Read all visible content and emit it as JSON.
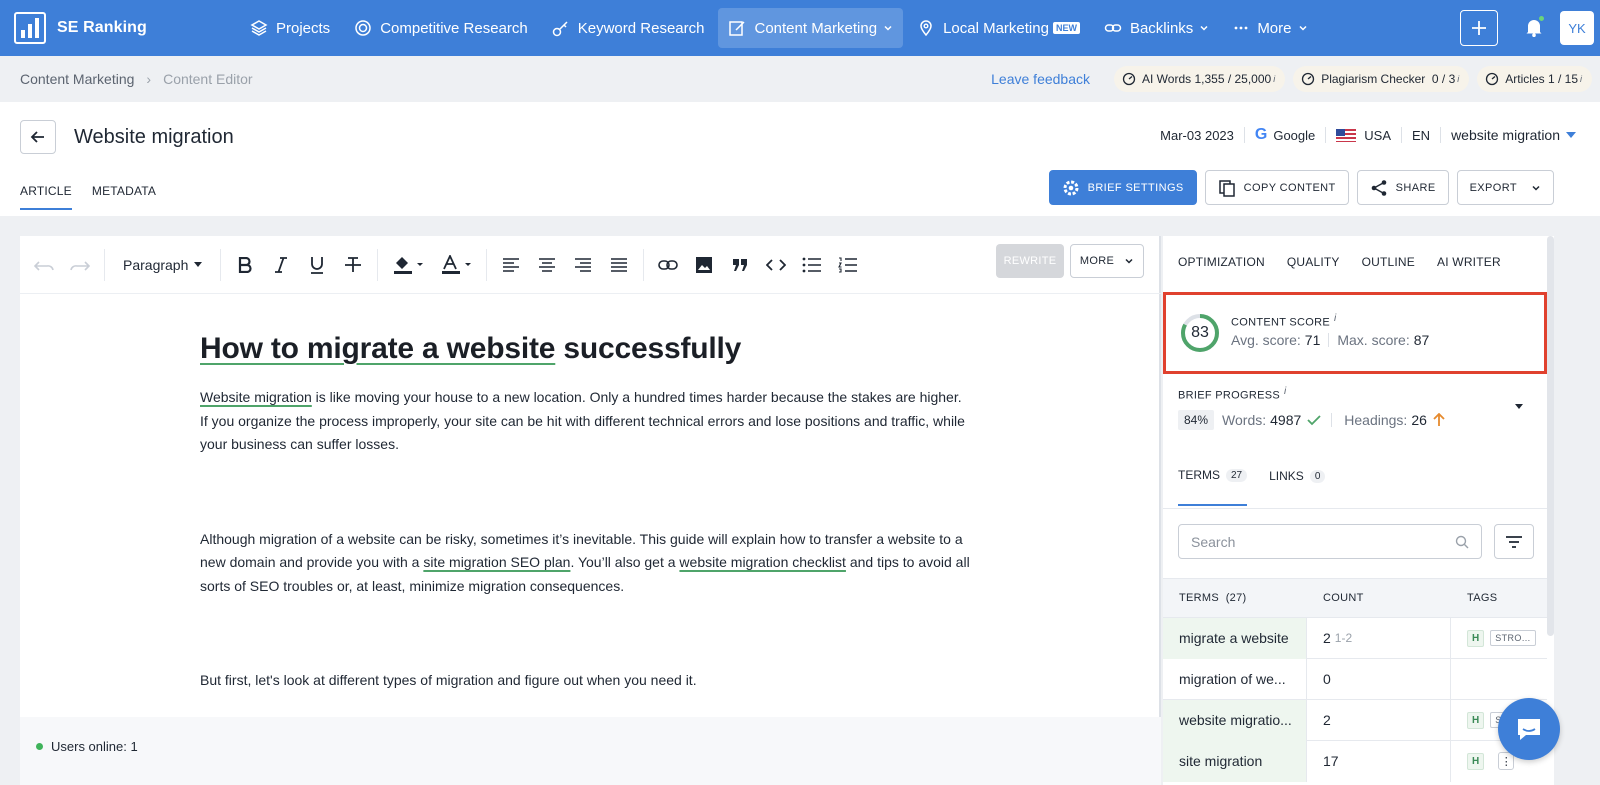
{
  "app": {
    "name": "SE Ranking",
    "avatar_initials": "YK",
    "brand_color": "#3e7fd8"
  },
  "nav": {
    "items": [
      {
        "label": "Projects",
        "icon": "layers-icon"
      },
      {
        "label": "Competitive Research",
        "icon": "target-icon"
      },
      {
        "label": "Keyword Research",
        "icon": "key-icon"
      },
      {
        "label": "Content Marketing",
        "icon": "edit-icon",
        "active": true
      },
      {
        "label": "Local Marketing",
        "icon": "pin-icon",
        "badge": "NEW"
      },
      {
        "label": "Backlinks",
        "icon": "link-icon"
      },
      {
        "label": "More",
        "icon": "dots-icon"
      }
    ]
  },
  "breadcrumb": {
    "parent": "Content Marketing",
    "current": "Content Editor"
  },
  "limits": {
    "feedback": "Leave feedback",
    "ai_words_label": "AI Words",
    "ai_words_value": "1,355 / 25,000",
    "plagiarism_label": "Plagiarism Checker",
    "plagiarism_value": "0 / 3",
    "articles_label": "Articles",
    "articles_value": "1 / 15",
    "info_mark": "i"
  },
  "document": {
    "title": "Website migration",
    "date": "Mar-03 2023",
    "engine_glyph": "G",
    "engine": "Google",
    "country": "USA",
    "language": "EN",
    "keyword": "website migration"
  },
  "tabs": {
    "article": "ARTICLE",
    "metadata": "METADATA"
  },
  "actions": {
    "brief_settings": "BRIEF SETTINGS",
    "copy_content": "COPY CONTENT",
    "share": "SHARE",
    "export": "EXPORT"
  },
  "toolbar": {
    "format": "Paragraph",
    "rewrite": "REWRITE",
    "more": "MORE"
  },
  "article": {
    "h1_part1": "How to migrate a website",
    "h1_part2": " successfully",
    "p1_link": "Website migration",
    "p1_rest": " is like moving your house to a new location. Only a hundred times harder because the stakes are higher. If you organize the process improperly, your site can be hit with different technical errors and lose positions and traffic, while your business can suffer losses.",
    "p2_a": "Although migration of a website can be risky, sometimes it’s inevitable. This guide will explain how to transfer a website to a new domain and provide you with a ",
    "p2_link1": "site migration SEO plan",
    "p2_b": ". You’ll also get a ",
    "p2_link2": "website migration checklist",
    "p2_c": " and tips to avoid all sorts of SEO troubles or, at least, minimize migration consequences.",
    "p3": "But first, let's look at different types of migration and figure out when you need it."
  },
  "status": {
    "online": "Users online: 1"
  },
  "sidebar": {
    "tabs": [
      "OPTIMIZATION",
      "QUALITY",
      "OUTLINE",
      "AI WRITER"
    ],
    "score": {
      "label": "CONTENT SCORE",
      "value": "83",
      "value_fraction": 0.83,
      "avg_label": "Avg. score:",
      "avg": "71",
      "max_label": "Max. score:",
      "max": "87",
      "info_mark": "i"
    },
    "brief": {
      "label": "BRIEF PROGRESS",
      "percent": "84%",
      "words_label": "Words:",
      "words": "4987",
      "headings_label": "Headings:",
      "headings": "26",
      "info_mark": "i"
    },
    "subtabs": [
      {
        "label": "TERMS",
        "count": "27"
      },
      {
        "label": "LINKS",
        "count": "0"
      }
    ],
    "search_placeholder": "Search",
    "table": {
      "headers": [
        "TERMS",
        "(27)",
        "COUNT",
        "TAGS"
      ],
      "rows": [
        {
          "term": "migrate a website",
          "count": "2",
          "range": "1-2",
          "tag_h": "H",
          "tag_s": "STRO..."
        },
        {
          "term": "migration of we...",
          "count": "0",
          "range": "",
          "tag_h": "",
          "tag_s": ""
        },
        {
          "term": "website migratio...",
          "count": "2",
          "range": "",
          "tag_h": "H",
          "tag_s": "ST"
        },
        {
          "term": "site migration",
          "count": "17",
          "range": "",
          "tag_h": "H",
          "tag_s": ""
        }
      ]
    }
  }
}
